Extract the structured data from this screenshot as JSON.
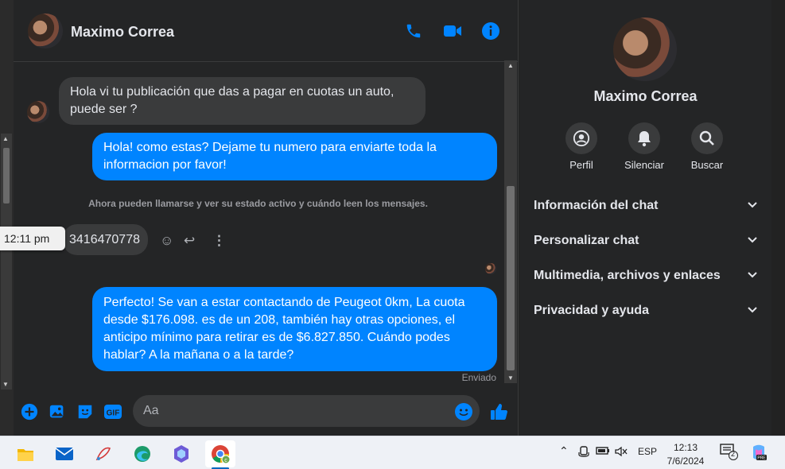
{
  "chat": {
    "contact_name": "Maximo Correa",
    "messages": {
      "incoming_1": "Hola vi tu publicación que das a pagar en cuotas un auto, puede ser ?",
      "outgoing_1": "Hola! como estas? Dejame tu numero para enviarte toda la informacion por favor!",
      "system_note": "Ahora pueden llamarse y ver su estado activo y cuándo leen los mensajes.",
      "incoming_2": "3416470778",
      "incoming_2_time": "12:11 pm",
      "outgoing_2": "Perfecto!  Se van a estar contactando de Peugeot 0km, La cuota desde $176.098. es de un 208, también hay otras opciones, el anticipo mínimo para retirar es de $6.827.850. Cuándo podes hablar? A la mañana o a la tarde?",
      "status": "Enviado"
    },
    "composer": {
      "placeholder": "Aa"
    },
    "accent_color": "#0084ff"
  },
  "info_panel": {
    "name": "Maximo Correa",
    "actions": [
      {
        "label": "Perfil",
        "icon": "profile-icon"
      },
      {
        "label": "Silenciar",
        "icon": "bell-icon"
      },
      {
        "label": "Buscar",
        "icon": "search-icon"
      }
    ],
    "sections": [
      "Información del chat",
      "Personalizar chat",
      "Multimedia, archivos y enlaces",
      "Privacidad y ayuda"
    ]
  },
  "taskbar": {
    "language": "ESP",
    "time": "12:13",
    "date": "7/6/2024",
    "notification_count": "2",
    "apps": [
      "file-explorer-icon",
      "mail-icon",
      "paint-icon",
      "edge-icon",
      "copilot-icon",
      "chrome-icon"
    ]
  }
}
